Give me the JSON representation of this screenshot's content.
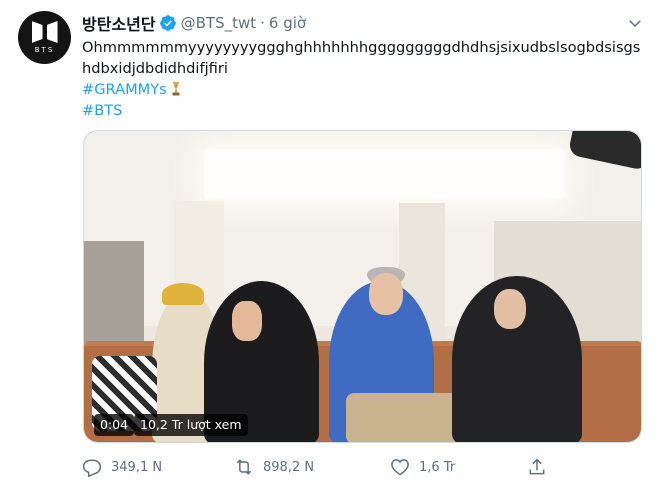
{
  "account": {
    "display_name": "방탄소년단",
    "handle": "@BTS_twt",
    "separator": "·",
    "time": "6 giờ",
    "avatar_wordmark": "BTS"
  },
  "tweet": {
    "text_line_1": "Ohmmmmmmyyyyyyyyggghghhhhhhhgggggggggdhdhsjsixudbslsogbdsisgs",
    "text_line_2": "hdbxidjdbdidhdifjfiri",
    "hashtag_1": "#GRAMMYs",
    "hashtag_2": "#BTS"
  },
  "media": {
    "duration": "0:04",
    "views": "10,2 Tr lượt xem"
  },
  "actions": {
    "reply_count": "349,1 N",
    "retweet_count": "898,2 N",
    "like_count": "1,6 Tr",
    "share_label": ""
  },
  "icons": {
    "verified": "verified-badge-icon",
    "caret": "caret-down-icon",
    "reply": "reply-icon",
    "retweet": "retweet-icon",
    "like": "heart-icon",
    "share": "share-icon",
    "trophy": "grammy-trophy-icon"
  },
  "colors": {
    "accent": "#1da1f2",
    "secondary_text": "#5b7083",
    "primary_text": "#0f1419"
  }
}
